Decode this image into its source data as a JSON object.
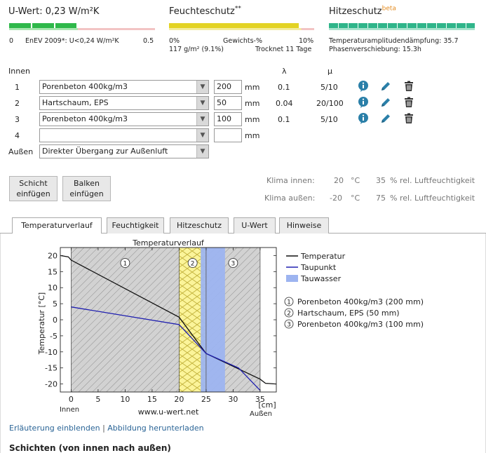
{
  "summary": {
    "uwert": {
      "title": "U-Wert: 0,23 W/m²K",
      "left_value": "0",
      "reference": "EnEV 2009*: U<0,24 W/m²K",
      "right_value": "0.5",
      "fill_fraction": 0.46
    },
    "feuchte": {
      "title": "Feuchteschutz",
      "title_sup": "**",
      "min": "0%",
      "unit": "Gewichts-%",
      "max": "10%",
      "line2_left": "117 g/m² (9.1%)",
      "line2_right": "Trocknet 11 Tage",
      "fill_fraction": 0.91
    },
    "hitze": {
      "title": "Hitzeschutz",
      "title_sup": "beta",
      "line1": "Temperaturamplitudendämpfung: 35.7",
      "line2": "Phasenverschiebung: 15.3h",
      "fill_fraction": 1.0
    }
  },
  "layers": {
    "header_inside": "Innen",
    "header_lambda": "λ",
    "header_mu": "μ",
    "unit": "mm",
    "rows": [
      {
        "num": "1",
        "material": "Porenbeton 400kg/m3",
        "thickness": "200",
        "lambda": "0.1",
        "mu": "5/10"
      },
      {
        "num": "2",
        "material": "Hartschaum, EPS",
        "thickness": "50",
        "lambda": "0.04",
        "mu": "20/100"
      },
      {
        "num": "3",
        "material": "Porenbeton 400kg/m3",
        "thickness": "100",
        "lambda": "0.1",
        "mu": "5/10"
      },
      {
        "num": "4",
        "material": "",
        "thickness": "",
        "lambda": "",
        "mu": ""
      }
    ],
    "outside_label": "Außen",
    "outside_value": "Direkter Übergang zur Außenluft"
  },
  "buttons": {
    "add_layer": [
      "Schicht",
      "einfügen"
    ],
    "add_beam": [
      "Balken",
      "einfügen"
    ]
  },
  "climate": {
    "inside_label": "Klima innen:",
    "inside_temp": "20",
    "inside_hum": "35",
    "outside_label": "Klima außen:",
    "outside_temp": "-20",
    "outside_hum": "75",
    "temp_unit": "°C",
    "hum_unit": "% rel. Luftfeuchtigkeit"
  },
  "tabs": [
    {
      "label": "Temperaturverlauf",
      "active": true
    },
    {
      "label": "Feuchtigkeit",
      "active": false
    },
    {
      "label": "Hitzeschutz",
      "active": false
    },
    {
      "label": "U-Wert",
      "active": false
    },
    {
      "label": "Hinweise",
      "active": false
    }
  ],
  "links": {
    "explain": "Erläuterung einblenden",
    "separator": "|",
    "download": "Abbildung herunterladen"
  },
  "section_heading": "Schichten (von innen nach außen)",
  "colors": {
    "green": "#2eb84a",
    "yellow": "#e3d323",
    "teal": "#2fb58a",
    "pink": "#f2c4c4",
    "blue_icon": "#2a7fa8",
    "temp_line": "#111111",
    "dew_line": "#2020b0",
    "condensate": "#9db4f0",
    "insulation": "#fbf49a"
  },
  "chart_data": {
    "type": "line",
    "title": "Temperaturverlauf",
    "xlabel": "[cm]",
    "ylabel": "Temperatur [°C]",
    "xlim": [
      -2,
      38
    ],
    "ylim": [
      -22.5,
      22.5
    ],
    "xticks": [
      0,
      5,
      10,
      15,
      20,
      25,
      30,
      35
    ],
    "yticks": [
      20,
      15,
      10,
      5,
      0,
      -5,
      -10,
      -15,
      -20
    ],
    "x_left_label": "Innen",
    "x_right_label": "Außen",
    "watermark": "www.u-wert.net",
    "layers": [
      {
        "num": "1",
        "from": 0,
        "to": 20,
        "fill": "hatch-gray"
      },
      {
        "num": "2",
        "from": 20,
        "to": 25,
        "fill": "insulation"
      },
      {
        "num": "3",
        "from": 25,
        "to": 35,
        "fill": "hatch-gray"
      }
    ],
    "condensate_zone": [
      24,
      28.5
    ],
    "series": [
      {
        "name": "Temperatur",
        "color": "#111111",
        "x": [
          -2,
          -0.5,
          0,
          20,
          25,
          35,
          36,
          38
        ],
        "y": [
          20,
          19.6,
          18.6,
          0.8,
          -10.5,
          -18.5,
          -19.8,
          -20
        ]
      },
      {
        "name": "Taupunkt",
        "color": "#2020b0",
        "x": [
          0,
          20,
          25,
          31,
          35
        ],
        "y": [
          4,
          -1.5,
          -10.5,
          -15,
          -22
        ]
      }
    ],
    "legend": [
      {
        "label": "Temperatur",
        "kind": "line",
        "color": "#111111"
      },
      {
        "label": "Taupunkt",
        "kind": "line",
        "color": "#2020b0"
      },
      {
        "label": "Tauwasser",
        "kind": "box",
        "color": "#9db4f0"
      }
    ],
    "layer_legend": [
      {
        "num": "1",
        "label": "Porenbeton 400kg/m3 (200 mm)"
      },
      {
        "num": "2",
        "label": "Hartschaum, EPS (50 mm)"
      },
      {
        "num": "3",
        "label": "Porenbeton 400kg/m3 (100 mm)"
      }
    ]
  }
}
